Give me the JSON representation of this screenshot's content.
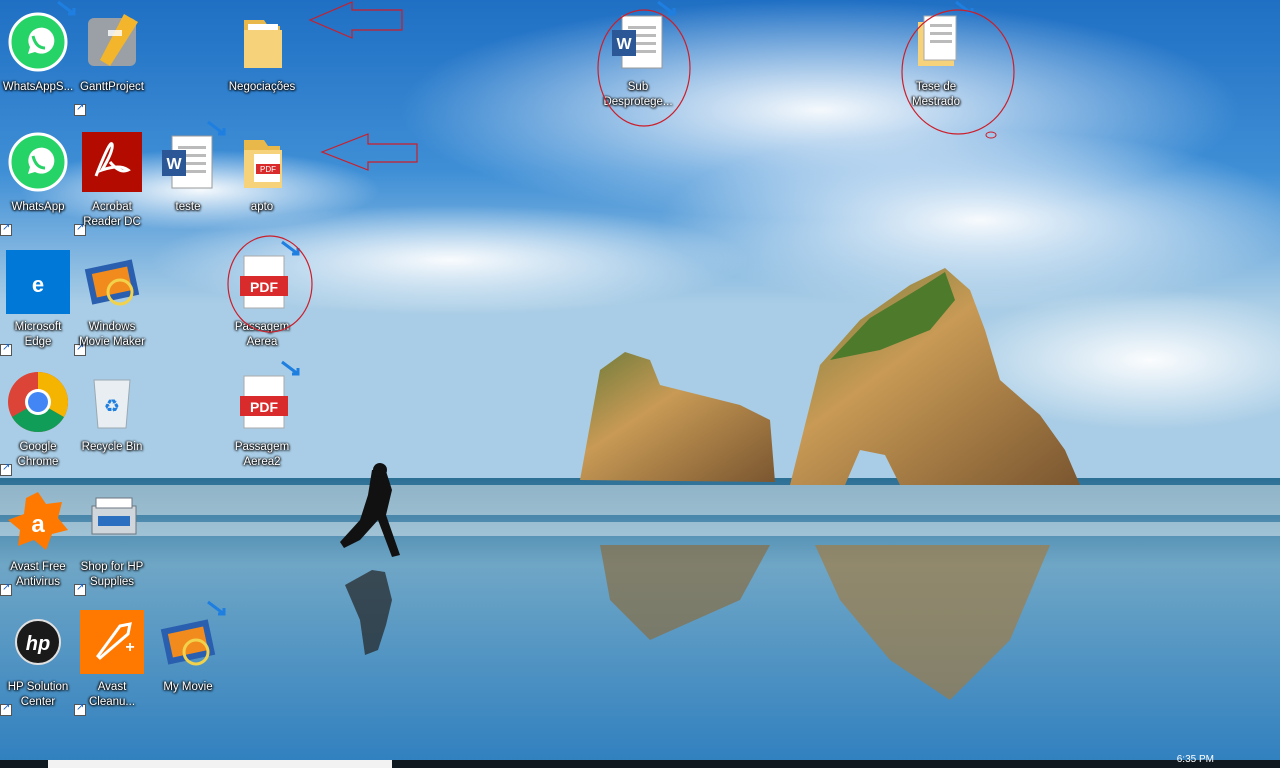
{
  "desktop": {
    "icons": [
      {
        "label": "WhatsAppS...",
        "icon": "whatsapp-icon"
      },
      {
        "label": "GanttProject",
        "icon": "gantt-icon"
      },
      {
        "label": "Negociações",
        "icon": "folder-icon"
      },
      {
        "label": "WhatsApp",
        "icon": "whatsapp-icon"
      },
      {
        "label": "Acrobat Reader DC",
        "icon": "acrobat-icon"
      },
      {
        "label": "teste",
        "icon": "word-doc-icon"
      },
      {
        "label": "apto",
        "icon": "folder-pdf-icon"
      },
      {
        "label": "Microsoft Edge",
        "icon": "edge-icon"
      },
      {
        "label": "Windows Movie Maker",
        "icon": "movie-maker-icon"
      },
      {
        "label": "Passagem Aerea",
        "icon": "pdf-icon"
      },
      {
        "label": "Google Chrome",
        "icon": "chrome-icon"
      },
      {
        "label": "Recycle Bin",
        "icon": "recycle-bin-icon"
      },
      {
        "label": "Passagem Aerea2",
        "icon": "pdf-icon"
      },
      {
        "label": "Avast Free Antivirus",
        "icon": "avast-icon"
      },
      {
        "label": "Shop for HP Supplies",
        "icon": "hp-shop-icon"
      },
      {
        "label": "HP Solution Center",
        "icon": "hp-icon"
      },
      {
        "label": "Avast Cleanu...",
        "icon": "avast-cleanup-icon"
      },
      {
        "label": "My Movie",
        "icon": "movie-maker-icon"
      },
      {
        "label": "Sub Desprotege...",
        "icon": "word-doc-icon"
      },
      {
        "label": "Tese de Mestrado",
        "icon": "document-icon"
      }
    ]
  },
  "taskbar": {
    "clock": "6:35 PM"
  },
  "colors": {
    "annotation": "#cc1e2a",
    "whatsapp": "#25d366",
    "acrobat": "#b30b00",
    "edge": "#0078d7",
    "avast": "#ff7800"
  }
}
